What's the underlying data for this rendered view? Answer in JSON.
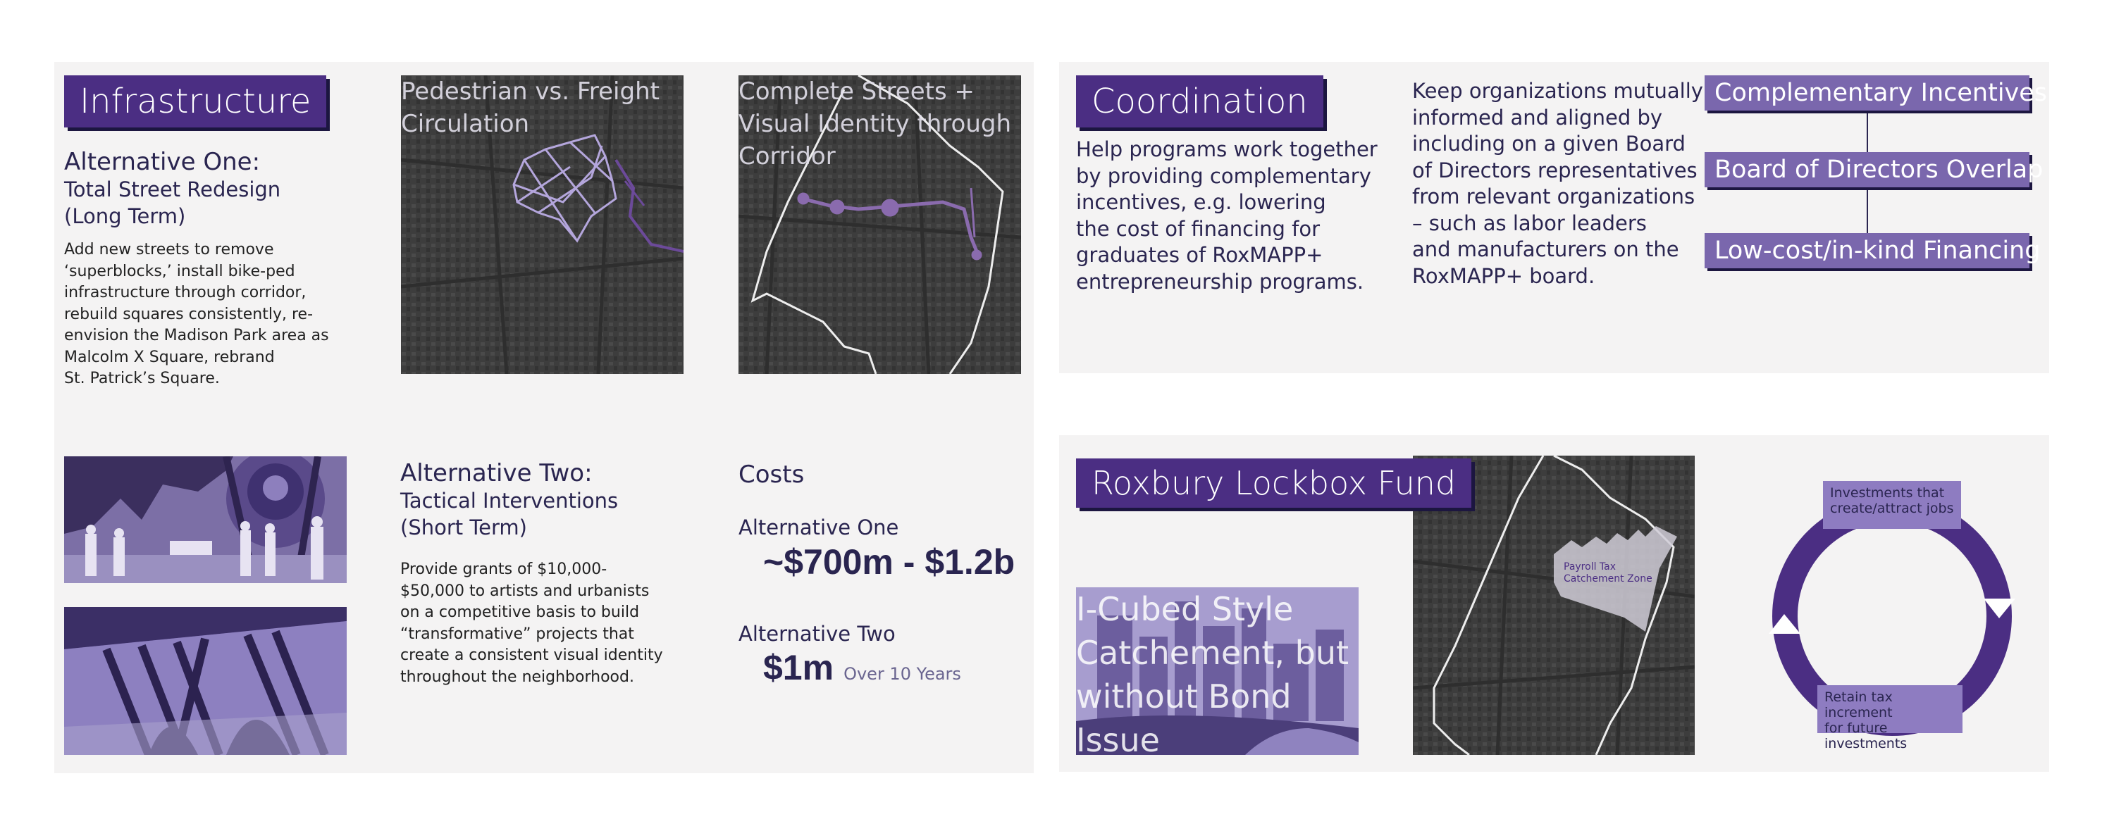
{
  "colors": {
    "accent": "#4b2e83",
    "accent_light": "#7a67ad",
    "panel_bg": "#f4f3f3",
    "text": "#2a2550"
  },
  "infrastructure": {
    "tag": "Infrastructure",
    "alt_one": {
      "title": "Alternative One:",
      "subtitle_1": "Total Street Redesign",
      "subtitle_2": "(Long Term)",
      "body": [
        "Add new streets to remove",
        "‘superblocks,’ install bike-ped",
        "infrastructure through corridor,",
        "rebuild squares consistently, re-",
        "envision the Madison Park area as",
        "Malcolm X Square, rebrand",
        "St. Patrick’s Square."
      ]
    },
    "map_one_title": [
      "Pedestrian vs. Freight",
      "Circulation"
    ],
    "map_two_title": [
      "Complete Streets +",
      "Visual Identity through",
      "Corridor"
    ],
    "alt_two": {
      "title": "Alternative Two:",
      "subtitle_1": "Tactical Interventions",
      "subtitle_2": "(Short Term)",
      "body": [
        "Provide grants of $10,000-",
        "$50,000 to artists and urbanists",
        "on a competitive basis to build",
        "“transformative” projects that",
        "create a consistent visual identity",
        "throughout the neighborhood."
      ]
    },
    "costs": {
      "heading": "Costs",
      "alt_one_label": "Alternative One",
      "alt_one_value": "~$700m - $1.2b",
      "alt_two_label": "Alternative Two",
      "alt_two_value": "$1m",
      "alt_two_note": "Over 10 Years"
    }
  },
  "coordination": {
    "tag": "Coordination",
    "col_one": [
      "Help programs work together",
      "by providing complementary",
      "incentives, e.g. lowering",
      "the cost of financing for",
      "graduates of RoxMAPP+",
      "entrepreneurship programs."
    ],
    "col_two": [
      "Keep organizations mutually",
      "informed and aligned by",
      "including on a given Board",
      "of Directors representatives",
      "from relevant organizations",
      "– such as labor leaders",
      "and manufacturers on the",
      "RoxMAPP+ board."
    ],
    "boxes": [
      "Complementary Incentives",
      "Board of Directors Overlap",
      "Low-cost/in-kind Financing"
    ]
  },
  "lockbox": {
    "tag": "Roxbury Lockbox Fund",
    "photo_caption": [
      "I-Cubed Style",
      "Catchement, but",
      "without Bond",
      "Issue"
    ],
    "map_label": [
      "Payroll Tax",
      "Catchement Zone"
    ],
    "cycle_top": [
      "Investments that",
      "create/attract jobs"
    ],
    "cycle_bottom": [
      "Retain tax increment",
      "for future investments"
    ]
  }
}
